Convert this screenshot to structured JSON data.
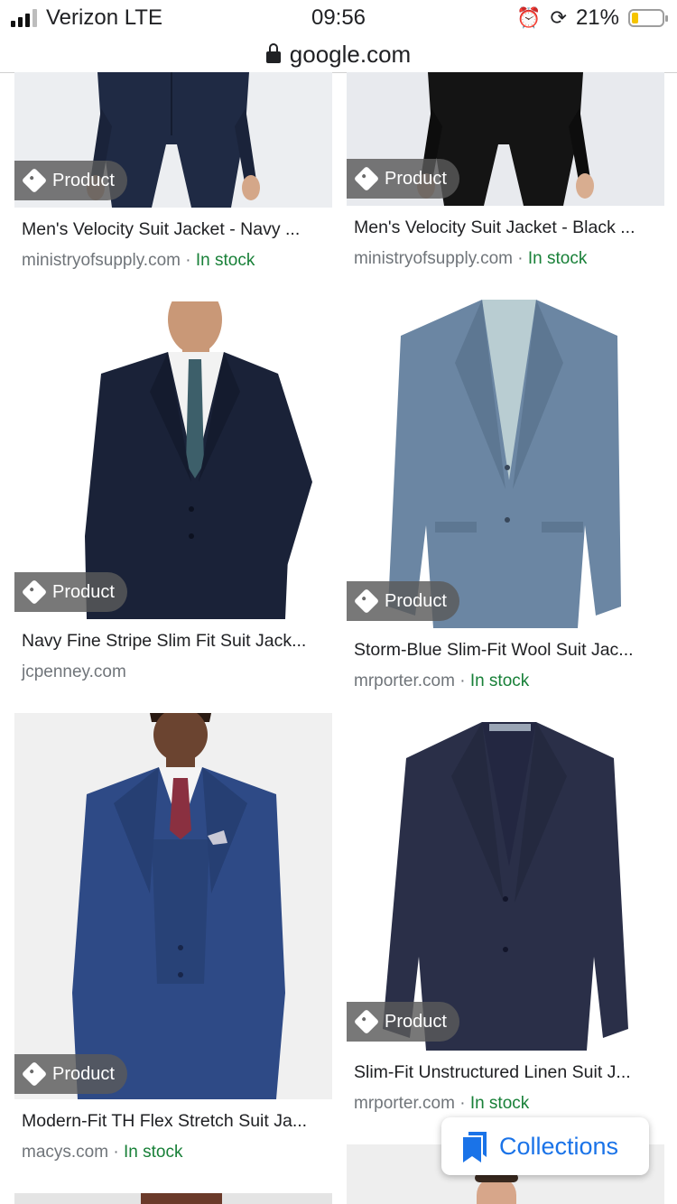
{
  "status_bar": {
    "carrier": "Verizon LTE",
    "time": "09:56",
    "battery": "21%",
    "battery_level": 0.21
  },
  "url_bar": {
    "domain": "google.com"
  },
  "badge_label": "Product",
  "products": [
    {
      "title": "Men's Velocity Suit Jacket - Navy ...",
      "source": "ministryofsupply.com",
      "separator": " · ",
      "stock": "In stock"
    },
    {
      "title": "Men's Velocity Suit Jacket - Black ...",
      "source": "ministryofsupply.com",
      "separator": " · ",
      "stock": "In stock"
    },
    {
      "title": "Navy Fine Stripe Slim Fit Suit Jack...",
      "source": "jcpenney.com",
      "separator": "",
      "stock": ""
    },
    {
      "title": "Storm-Blue Slim-Fit Wool Suit Jac...",
      "source": "mrporter.com",
      "separator": " · ",
      "stock": "In stock"
    },
    {
      "title": "Modern-Fit TH Flex Stretch Suit Ja...",
      "source": "macys.com",
      "separator": " · ",
      "stock": "In stock"
    },
    {
      "title": "Slim-Fit Unstructured Linen Suit J...",
      "source": "mrporter.com",
      "separator": " · ",
      "stock": "In stock"
    }
  ],
  "collections": {
    "label": "Collections"
  },
  "colors": {
    "link_blue": "#1a73e8",
    "stock_green": "#188038",
    "meta_gray": "#70757a"
  }
}
